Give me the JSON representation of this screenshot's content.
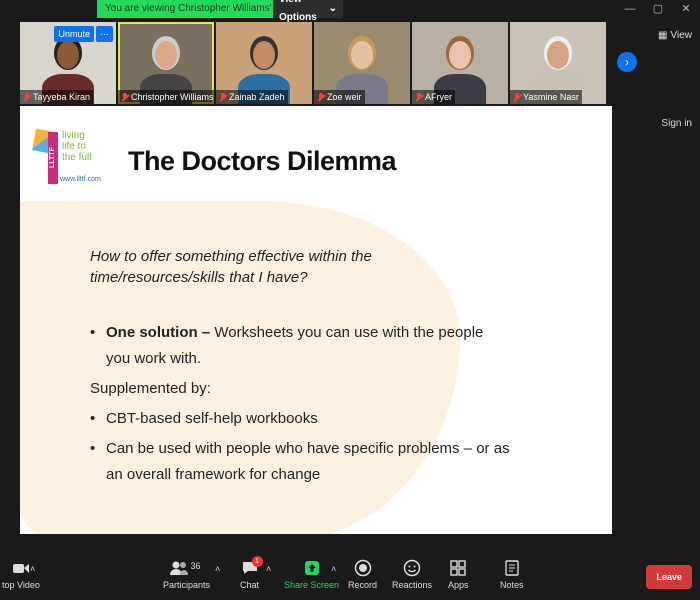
{
  "banner": {
    "message": "You are viewing Christopher Williams' screen",
    "options_label": "View Options"
  },
  "window_controls": [
    "—",
    "▢",
    "✕"
  ],
  "gallery": {
    "participants": [
      {
        "name": "Tayyeba Kiran",
        "skin": "#8a5a3c",
        "hair": "#222",
        "shirt": "#6b2a2a",
        "bg": "#d8d5cc"
      },
      {
        "name": "Christopher Williams",
        "skin": "#d9a98a",
        "hair": "#ccc",
        "shirt": "#444",
        "bg": "#7a7060",
        "active": true
      },
      {
        "name": "Zainab Zadeh",
        "skin": "#c48a6a",
        "hair": "#333",
        "shirt": "#2d6fa3",
        "bg": "#caa27a"
      },
      {
        "name": "Zoe weir",
        "skin": "#e6c1a3",
        "hair": "#c89a5a",
        "shirt": "#7a7a8a",
        "bg": "#9a8a70"
      },
      {
        "name": "AFryer",
        "skin": "#e8c4ae",
        "hair": "#a0663a",
        "shirt": "#3c3c44",
        "bg": "#b9b0a5"
      },
      {
        "name": "Yasmine Nasr",
        "skin": "#d6a383",
        "hair": "#eee",
        "shirt": "#c9c2b4",
        "bg": "#c8c3b6"
      }
    ],
    "unmute_label": "Unmute",
    "more_label": "···",
    "next_label": "›"
  },
  "side": {
    "view_label": "View",
    "signin_label": "Sign in"
  },
  "slide": {
    "logo": {
      "bar_text": "LLTTF",
      "tag_lines": [
        "living",
        "life to",
        "the full"
      ],
      "url": "www.llttf.com"
    },
    "title": "The Doctors Dilemma",
    "question": "How to offer something effective within the time/resources/skills that I have?",
    "bullet1_bold": "One solution –",
    "bullet1_rest": " Worksheets you can use with the people you work with.",
    "supplemented": "Supplemented by:",
    "bullet2": "CBT-based self-help workbooks",
    "bullet3": "Can be used with people who have specific problems – or as an overall framework for change"
  },
  "toolbar": {
    "stop_video": "top Video",
    "participants": "Participants",
    "participants_count": "36",
    "chat": "Chat",
    "chat_badge": "1",
    "share_screen": "Share Screen",
    "record": "Record",
    "reactions": "Reactions",
    "apps": "Apps",
    "notes": "Notes",
    "leave": "Leave"
  }
}
